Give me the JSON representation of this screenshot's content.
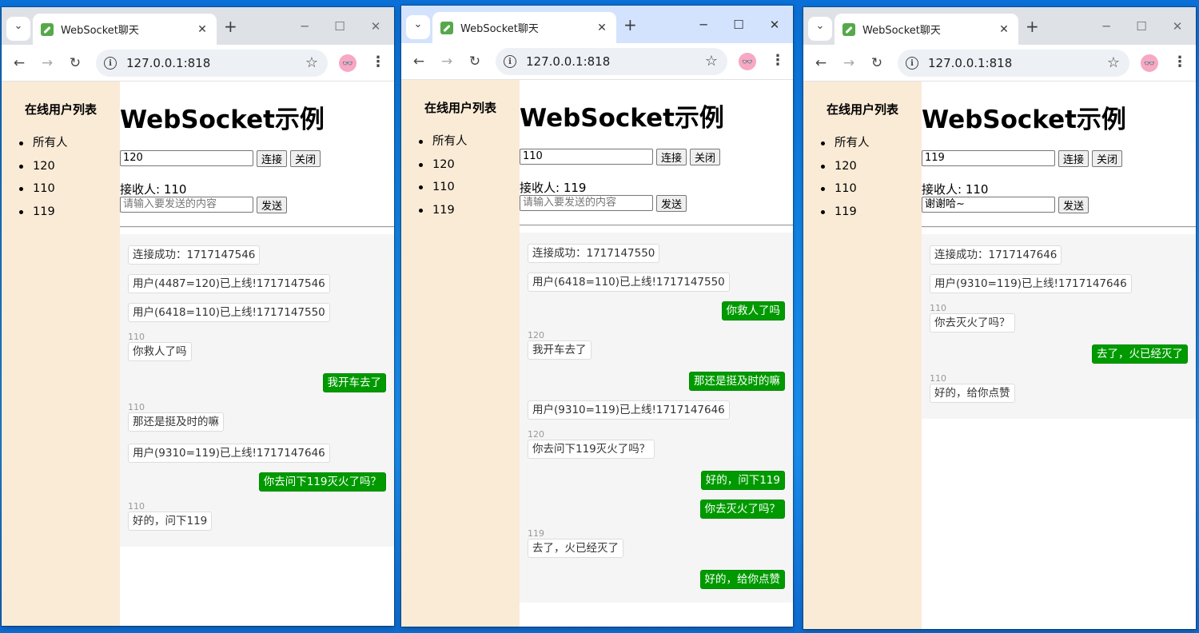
{
  "common": {
    "tab_title": "WebSocket聊天",
    "url": "127.0.0.1:818",
    "heading": "WebSocket示例",
    "sidebar_title": "在线用户列表",
    "users": [
      "所有人",
      "120",
      "110",
      "119"
    ],
    "connect_label": "连接",
    "close_label": "关闭",
    "send_label": "发送",
    "receiver_label": "接收人: ",
    "message_placeholder": "请输入要发送的内容",
    "icons": {
      "tab_dropdown": "chevron-down-icon",
      "tab_close": "close-icon",
      "new_tab": "plus-icon",
      "back": "back-arrow-icon",
      "forward": "forward-arrow-icon",
      "reload": "reload-icon",
      "site_info": "info-icon",
      "bookmark": "star-icon",
      "menu": "kebab-menu-icon"
    },
    "colors": {
      "sidebar_bg": "#faebd7",
      "outgoing_bubble": "#009a00",
      "chat_bg": "#f5f5f5",
      "tabstrip_inactive": "#dee1e6",
      "tabstrip_active": "#d3e3fd"
    }
  },
  "windows": [
    {
      "user_id": "120",
      "receiver": "110",
      "message_text": "",
      "messages": [
        {
          "dir": "in",
          "sender": "",
          "text": "连接成功：1717147546"
        },
        {
          "dir": "in",
          "sender": "",
          "text": "用户(4487=120)已上线!1717147546"
        },
        {
          "dir": "in",
          "sender": "",
          "text": "用户(6418=110)已上线!1717147550"
        },
        {
          "dir": "in",
          "sender": "110",
          "text": "你救人了吗"
        },
        {
          "dir": "out",
          "sender": "",
          "text": "我开车去了"
        },
        {
          "dir": "in",
          "sender": "110",
          "text": "那还是挺及时的嘛"
        },
        {
          "dir": "in",
          "sender": "",
          "text": "用户(9310=119)已上线!1717147646"
        },
        {
          "dir": "out",
          "sender": "",
          "text": "你去问下119灭火了吗？"
        },
        {
          "dir": "in",
          "sender": "110",
          "text": "好的，问下119"
        }
      ]
    },
    {
      "user_id": "110",
      "receiver": "119",
      "message_text": "",
      "messages": [
        {
          "dir": "in",
          "sender": "",
          "text": "连接成功：1717147550"
        },
        {
          "dir": "in",
          "sender": "",
          "text": "用户(6418=110)已上线!1717147550"
        },
        {
          "dir": "out",
          "sender": "",
          "text": "你救人了吗"
        },
        {
          "dir": "in",
          "sender": "120",
          "text": "我开车去了"
        },
        {
          "dir": "out",
          "sender": "",
          "text": "那还是挺及时的嘛"
        },
        {
          "dir": "in",
          "sender": "",
          "text": "用户(9310=119)已上线!1717147646"
        },
        {
          "dir": "in",
          "sender": "120",
          "text": "你去问下119灭火了吗？"
        },
        {
          "dir": "out",
          "sender": "",
          "text": "好的，问下119"
        },
        {
          "dir": "out",
          "sender": "",
          "text": "你去灭火了吗？"
        },
        {
          "dir": "in",
          "sender": "119",
          "text": "去了，火已经灭了"
        },
        {
          "dir": "out",
          "sender": "",
          "text": "好的，给你点赞"
        }
      ]
    },
    {
      "user_id": "119",
      "receiver": "110",
      "message_text": "谢谢哈~",
      "messages": [
        {
          "dir": "in",
          "sender": "",
          "text": "连接成功：1717147646"
        },
        {
          "dir": "in",
          "sender": "",
          "text": "用户(9310=119)已上线!1717147646"
        },
        {
          "dir": "in",
          "sender": "110",
          "text": "你去灭火了吗？"
        },
        {
          "dir": "out",
          "sender": "",
          "text": "去了，火已经灭了"
        },
        {
          "dir": "in",
          "sender": "110",
          "text": "好的，给你点赞"
        }
      ]
    }
  ]
}
